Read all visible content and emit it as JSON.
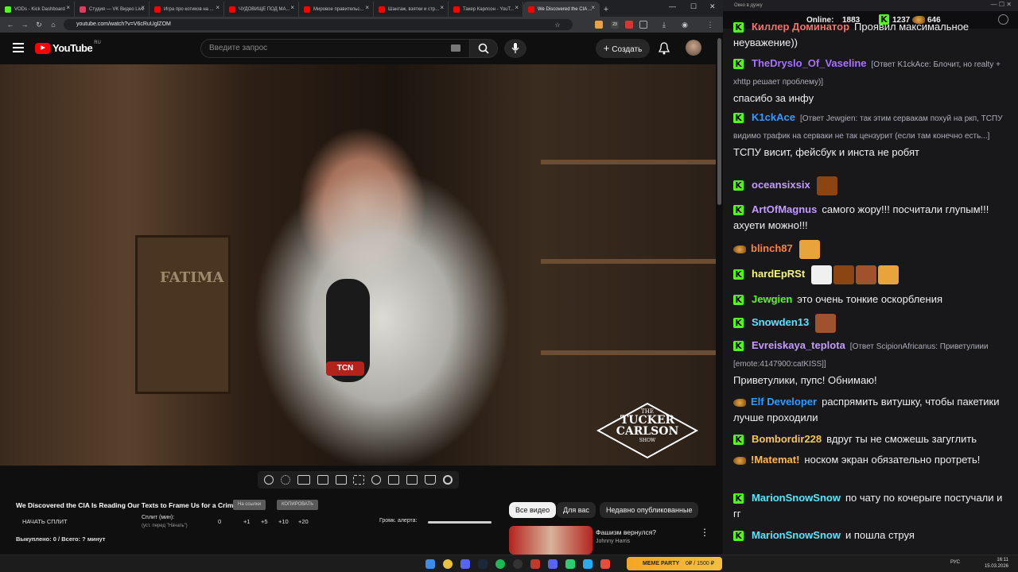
{
  "browser": {
    "tabs": [
      {
        "label": "VODs - Kick Dashboard",
        "color": "#53fc18"
      },
      {
        "label": "Студия — VK Видео Live",
        "color": "#e03c63"
      },
      {
        "label": "Игра про котиков на ...",
        "color": "#ff0000"
      },
      {
        "label": "ЧУДОВИЩЕ ПОД МА...",
        "color": "#ff0000"
      },
      {
        "label": "Мировое правительс...",
        "color": "#ff0000"
      },
      {
        "label": "Шантаж, взятки и стр...",
        "color": "#ff0000"
      },
      {
        "label": "Такер Карлсон - YouT...",
        "color": "#ff0000"
      },
      {
        "label": "We Discovered the CIA ...",
        "color": "#ff0000",
        "active": true
      }
    ],
    "url": "youtube.com/watch?v=V6cRuUglZOM",
    "ext_badge": "23"
  },
  "youtube": {
    "logo_text": "YouTube",
    "region": "RU",
    "search_placeholder": "Введите запрос",
    "create_label": "Создать",
    "video_title": "We Discovered the CIA Is Reading Our Texts to Frame Us for a Crime",
    "btn_copy_title": "На ссылки",
    "btn_copy": "КОПИРОВАТЬ",
    "split_start": "НАЧАТЬ СПЛИТ",
    "split_label": "Сплит (мин):",
    "split_hint": "(уст. перед \"Начать\")",
    "split_value": "0",
    "split_steps": [
      "+1",
      "+5",
      "+10",
      "+20"
    ],
    "alert_label": "Громк. алерта:",
    "bought": "Выкуплено: 0 / Всего: ? минут",
    "chips": [
      "Все видео",
      "Для вас",
      "Недавно опубликованные"
    ],
    "rec_title": "Фашизм вернулся?",
    "rec_channel": "Johnny Harris",
    "brand_top": "THE",
    "brand_main1": "TUCKER",
    "brand_main2": "CARLSON",
    "brand_bottom": "SHOW",
    "mic_brand": "TCN",
    "poster_text": "FATIMA"
  },
  "chat": {
    "window_title": "Окно в дуэку",
    "online_label": "Online:",
    "online_count": "1883",
    "kick_count": "1237",
    "other_count": "646",
    "messages": [
      {
        "name": "Киллер Доминатор",
        "color": "#ff6b6b",
        "text": "Проявил максимальное неуважение))"
      },
      {
        "name": "TheDryslo_Of_Vaseline",
        "color": "#a970ff",
        "reply": "[Ответ K1ckAce: Блочит, но realty + xhttp решает проблему)]",
        "text": "спасибо за инфу"
      },
      {
        "name": "K1ckAce",
        "color": "#2e9bff",
        "reply": "[Ответ Jewgien: так этим сервакам похуй на ркп, ТСПУ видимо трафик на серваки не так цензурит (если там конечно есть...]",
        "text": "ТСПУ висит, фейсбук и инста не робят"
      },
      {
        "name": "oceansixsix",
        "color": "#c49bff",
        "text": ""
      },
      {
        "name": "ArtOfMagnus",
        "color": "#c49bff",
        "text": "самого жору!!! посчитали глупым!!! ахуети можно!!!"
      },
      {
        "name": "blinch87",
        "color": "#ff7f3f",
        "text": ""
      },
      {
        "name": "hardEpRSt",
        "color": "#f5f57a",
        "text": ""
      },
      {
        "name": "Jewgien",
        "color": "#53fc18",
        "text": "это очень тонкие оскорбления"
      },
      {
        "name": "Snowden13",
        "color": "#55e6ff",
        "text": ""
      },
      {
        "name": "Evreiskaya_teplota",
        "color": "#c49bff",
        "reply": "[Ответ ScipionAfricanus: Приветулиии [emote:4147900:catKISS]]",
        "text": "Приветулики, пупс! Обнимаю!"
      },
      {
        "name": "Elf Developer",
        "color": "#2e9bff",
        "text": "распрямить витушку, чтобы пакетики лучше проходили"
      },
      {
        "name": "Bombordir228",
        "color": "#f5c84c",
        "text": "вдруг ты не сможешь загуглить"
      },
      {
        "name": "!Matemat!",
        "color": "#ffb84c",
        "text": "носком экран обязательно протреть!"
      },
      {
        "name": "MarionSnowSnow",
        "color": "#55e6ff",
        "text": "по чату по кочерыге постучали и гг"
      },
      {
        "name": "MarionSnowSnow",
        "color": "#55e6ff",
        "text": "и пошла струя"
      }
    ]
  },
  "taskbar": {
    "meme_label": "MEME PARTY",
    "meme_value": "0₽ / 1500 ₽",
    "lang": "РУС",
    "time": "16:11",
    "date": "15.03.2026"
  }
}
